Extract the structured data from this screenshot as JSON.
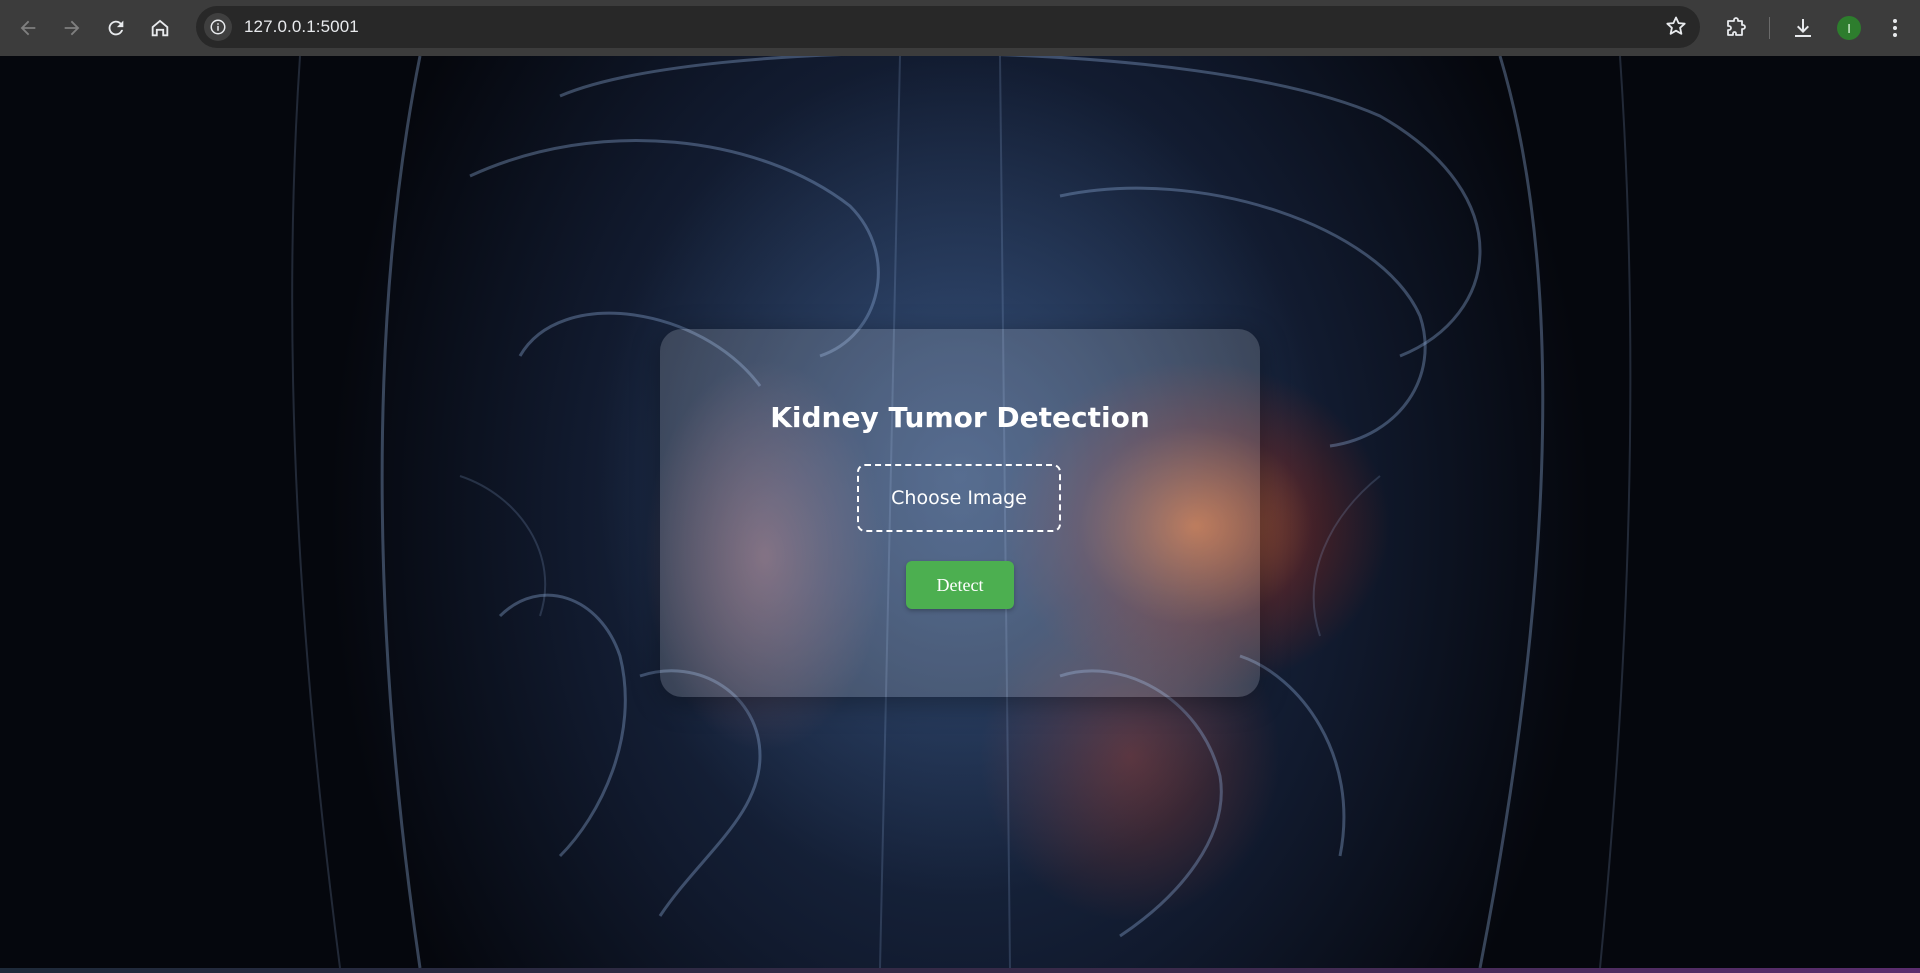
{
  "browser": {
    "url": "127.0.0.1:5001",
    "avatar_letter": "I",
    "icons": {
      "back": "arrow-left-icon",
      "forward": "arrow-right-icon",
      "reload": "reload-icon",
      "home": "home-icon",
      "site_info": "info-icon",
      "bookmark": "star-icon",
      "extensions": "puzzle-icon",
      "downloads": "download-icon",
      "menu": "kebab-menu-icon"
    },
    "avatar_color": "#2d7d2d"
  },
  "page": {
    "title": "Kidney Tumor Detection",
    "choose_label": "Choose Image",
    "detect_label": "Detect",
    "colors": {
      "detect_button": "#4caf50",
      "text": "#ffffff",
      "card_background": "rgba(255,255,255,0.16)"
    }
  }
}
